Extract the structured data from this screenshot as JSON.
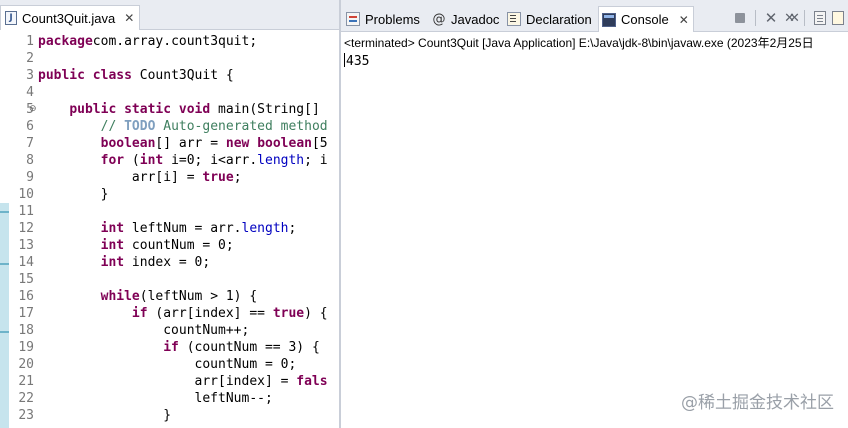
{
  "editor": {
    "tab": {
      "title": "Count3Quit.java",
      "close": "✕"
    },
    "code": [
      {
        "n": "1",
        "fold": "",
        "parts": [
          [
            "kw",
            "package"
          ],
          [
            "",
            "com.array.count3quit;"
          ]
        ]
      },
      {
        "n": "2",
        "fold": "",
        "parts": []
      },
      {
        "n": "3",
        "fold": "",
        "parts": [
          [
            "kw",
            "public"
          ],
          [
            "",
            " "
          ],
          [
            "kw",
            "class"
          ],
          [
            "",
            " Count3Quit {"
          ]
        ]
      },
      {
        "n": "4",
        "fold": "",
        "parts": []
      },
      {
        "n": "5",
        "fold": "⊖",
        "parts": [
          [
            "",
            "    "
          ],
          [
            "kw",
            "public"
          ],
          [
            "",
            " "
          ],
          [
            "kw",
            "static"
          ],
          [
            "",
            " "
          ],
          [
            "kw",
            "void"
          ],
          [
            "",
            " main(String[]"
          ]
        ]
      },
      {
        "n": "6",
        "fold": "",
        "parts": [
          [
            "",
            "        "
          ],
          [
            "cm",
            "// "
          ],
          [
            "todo",
            "TODO"
          ],
          [
            "cm",
            " Auto-generated method"
          ]
        ]
      },
      {
        "n": "7",
        "fold": "",
        "parts": [
          [
            "",
            "        "
          ],
          [
            "kw",
            "boolean"
          ],
          [
            "",
            "[] arr = "
          ],
          [
            "kw",
            "new"
          ],
          [
            "",
            " "
          ],
          [
            "kw",
            "boolean"
          ],
          [
            "",
            "[5"
          ]
        ]
      },
      {
        "n": "8",
        "fold": "",
        "parts": [
          [
            "",
            "        "
          ],
          [
            "kw",
            "for"
          ],
          [
            "",
            " ("
          ],
          [
            "kw",
            "int"
          ],
          [
            "",
            " i=0; i<arr."
          ],
          [
            "fl",
            "length"
          ],
          [
            "",
            "; i"
          ]
        ]
      },
      {
        "n": "9",
        "fold": "",
        "parts": [
          [
            "",
            "            arr[i] = "
          ],
          [
            "kw",
            "true"
          ],
          [
            "",
            ";"
          ]
        ]
      },
      {
        "n": "10",
        "fold": "",
        "parts": [
          [
            "",
            "        }"
          ]
        ]
      },
      {
        "n": "11",
        "fold": "",
        "parts": []
      },
      {
        "n": "12",
        "fold": "",
        "parts": [
          [
            "",
            "        "
          ],
          [
            "kw",
            "int"
          ],
          [
            "",
            " leftNum = arr."
          ],
          [
            "fl",
            "length"
          ],
          [
            "",
            ";"
          ]
        ]
      },
      {
        "n": "13",
        "fold": "",
        "parts": [
          [
            "",
            "        "
          ],
          [
            "kw",
            "int"
          ],
          [
            "",
            " countNum = 0;"
          ]
        ]
      },
      {
        "n": "14",
        "fold": "",
        "parts": [
          [
            "",
            "        "
          ],
          [
            "kw",
            "int"
          ],
          [
            "",
            " index = 0;"
          ]
        ]
      },
      {
        "n": "15",
        "fold": "",
        "parts": []
      },
      {
        "n": "16",
        "fold": "",
        "parts": [
          [
            "",
            "        "
          ],
          [
            "kw",
            "while"
          ],
          [
            "",
            "(leftNum > 1) {"
          ]
        ]
      },
      {
        "n": "17",
        "fold": "",
        "parts": [
          [
            "",
            "            "
          ],
          [
            "kw",
            "if"
          ],
          [
            "",
            " (arr[index] == "
          ],
          [
            "kw",
            "true"
          ],
          [
            "",
            ") {"
          ]
        ]
      },
      {
        "n": "18",
        "fold": "",
        "parts": [
          [
            "",
            "                countNum++;"
          ]
        ]
      },
      {
        "n": "19",
        "fold": "",
        "parts": [
          [
            "",
            "                "
          ],
          [
            "kw",
            "if"
          ],
          [
            "",
            " (countNum == 3) {"
          ]
        ]
      },
      {
        "n": "20",
        "fold": "",
        "parts": [
          [
            "",
            "                    countNum = 0;"
          ]
        ]
      },
      {
        "n": "21",
        "fold": "",
        "parts": [
          [
            "",
            "                    arr[index] = "
          ],
          [
            "kw",
            "fals"
          ]
        ]
      },
      {
        "n": "22",
        "fold": "",
        "parts": [
          [
            "",
            "                    leftNum--;"
          ]
        ]
      },
      {
        "n": "23",
        "fold": "",
        "parts": [
          [
            "",
            "                }"
          ]
        ]
      }
    ]
  },
  "console": {
    "tabs": [
      {
        "label": "Problems",
        "icon": "problems-icon"
      },
      {
        "label": "Javadoc",
        "icon": "at-icon",
        "glyph": "@"
      },
      {
        "label": "Declaration",
        "icon": "declaration-icon"
      },
      {
        "label": "Console",
        "icon": "console-icon",
        "close": "✕",
        "active": true
      }
    ],
    "status": "<terminated> Count3Quit [Java Application] E:\\Java\\jdk-8\\bin\\javaw.exe  (2023年2月25日",
    "output": "435"
  },
  "watermark": "@稀土掘金技术社区"
}
